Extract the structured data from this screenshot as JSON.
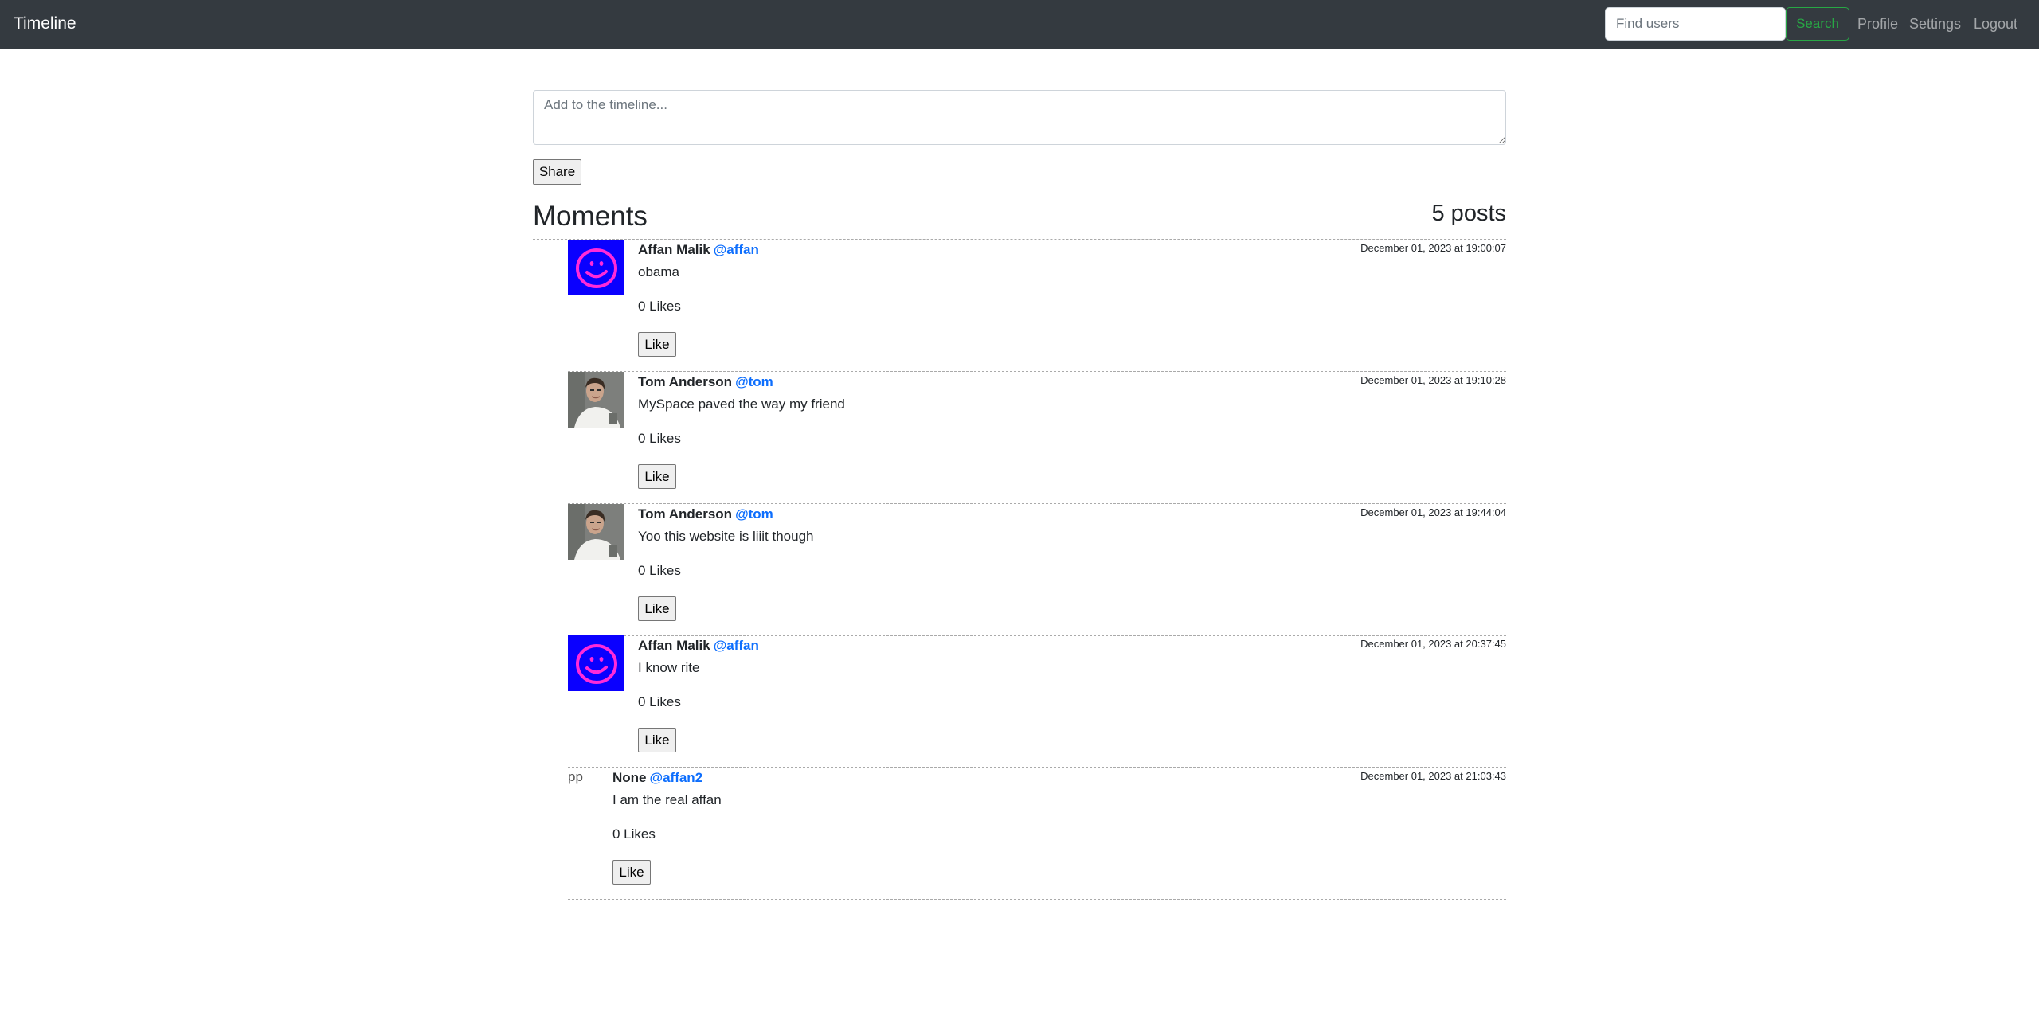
{
  "navbar": {
    "brand": "Timeline",
    "search_placeholder": "Find users",
    "search_label": "Search",
    "links": {
      "profile": "Profile",
      "settings": "Settings",
      "logout": "Logout"
    }
  },
  "composer": {
    "placeholder": "Add to the timeline...",
    "share_label": "Share"
  },
  "feed": {
    "title": "Moments",
    "count_label": "5 posts"
  },
  "posts": [
    {
      "name": "Affan Malik",
      "handle": "@affan",
      "date": "December 01, 2023 at 19:00:07",
      "text": "obama",
      "likes": "0 Likes",
      "like_label": "Like",
      "avatar": "smiley-avatar"
    },
    {
      "name": "Tom Anderson",
      "handle": "@tom",
      "date": "December 01, 2023 at 19:10:28",
      "text": "MySpace paved the way my friend",
      "likes": "0 Likes",
      "like_label": "Like",
      "avatar": "photo-avatar"
    },
    {
      "name": "Tom Anderson",
      "handle": "@tom",
      "date": "December 01, 2023 at 19:44:04",
      "text": "Yoo this website is liiit though",
      "likes": "0 Likes",
      "like_label": "Like",
      "avatar": "photo-avatar"
    },
    {
      "name": "Affan Malik",
      "handle": "@affan",
      "date": "December 01, 2023 at 20:37:45",
      "text": "I know rite",
      "likes": "0 Likes",
      "like_label": "Like",
      "avatar": "smiley-avatar"
    },
    {
      "name": "None",
      "handle": "@affan2",
      "date": "December 01, 2023 at 21:03:43",
      "text": "I am the real affan",
      "likes": "0 Likes",
      "like_label": "Like",
      "avatar": "broken-image",
      "avatar_alt": "pp"
    }
  ],
  "colors": {
    "navbar_bg": "#343a40",
    "search_accent": "#28a745",
    "handle_link": "#0d6efd",
    "smiley_bg": "#0a00ff",
    "smiley_stroke": "#ff2ad9"
  }
}
